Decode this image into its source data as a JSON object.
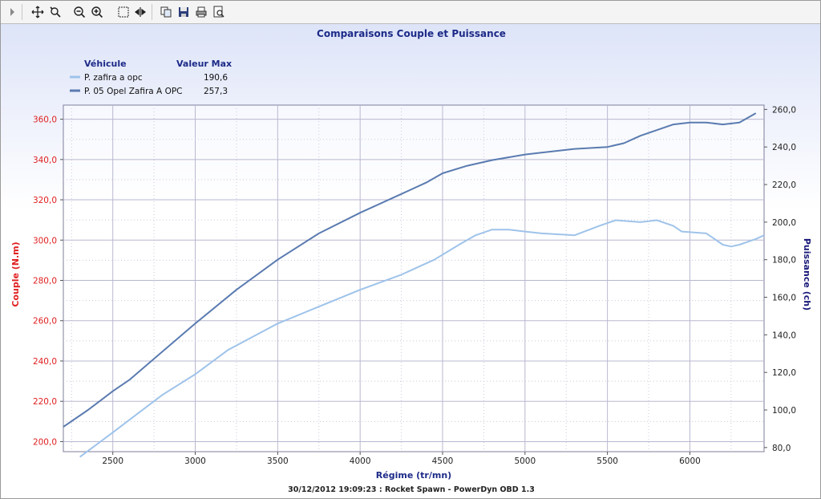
{
  "toolbar": {
    "icons": [
      "expand-arrow-icon",
      "pan-icon",
      "zoom-select-icon",
      "zoom-out-icon",
      "zoom-in-icon",
      "select-box-icon",
      "fit-width-icon",
      "copy-icon",
      "save-icon",
      "print-icon",
      "print-preview-icon"
    ]
  },
  "colors": {
    "torque_axis": "#e02020",
    "power_axis": "#1a1a7a",
    "series_light": "#9fc3ea",
    "series_dark": "#5a7bb0",
    "title": "#1c2a88"
  },
  "legend": {
    "header_vehicle": "Véhicule",
    "header_max": "Valeur Max",
    "entries": [
      {
        "name": "P. zafira a opc",
        "max": "190,6"
      },
      {
        "name": "P. 05 Opel Zafira A OPC",
        "max": "257,3"
      }
    ]
  },
  "footer": "30/12/2012 19:09:23 : Rocket Spawn - PowerDyn OBD 1.3",
  "chart_data": {
    "type": "line",
    "title": "Comparaisons Couple et Puissance",
    "xlabel": "Régime (tr/mn)",
    "ylabel": "Couple (N.m)",
    "y2label": "Puissance (ch)",
    "xlim": [
      2200,
      6450
    ],
    "ylim": [
      195,
      367
    ],
    "y2lim": [
      77.8,
      262.3
    ],
    "x_ticks": [
      "2500",
      "3000",
      "3500",
      "4000",
      "4500",
      "5000",
      "5500",
      "6000"
    ],
    "y_ticks": [
      "200,0",
      "220,0",
      "240,0",
      "260,0",
      "280,0",
      "300,0",
      "320,0",
      "340,0",
      "360,0"
    ],
    "y2_ticks": [
      "80,0",
      "100,0",
      "120,0",
      "140,0",
      "160,0",
      "180,0",
      "200,0",
      "220,0",
      "240,0",
      "260,0"
    ],
    "grid": true,
    "legend_position": "top-left",
    "series": [
      {
        "name": "P. zafira a opc",
        "axis": "right",
        "x": [
          2300,
          2500,
          2650,
          2800,
          3000,
          3200,
          3500,
          3750,
          4000,
          4250,
          4450,
          4600,
          4700,
          4800,
          4900,
          5000,
          5100,
          5300,
          5450,
          5550,
          5700,
          5800,
          5900,
          5950,
          6100,
          6200,
          6250,
          6300,
          6400,
          6450
        ],
        "values": [
          75,
          88,
          98,
          108,
          119,
          132,
          146,
          155,
          164,
          172,
          180,
          188,
          193,
          196,
          196,
          195,
          194,
          193,
          198,
          201,
          200,
          201,
          198,
          195,
          194,
          188,
          187,
          188,
          191,
          193
        ]
      },
      {
        "name": "P. 05 Opel Zafira A OPC",
        "axis": "right",
        "x": [
          2200,
          2350,
          2500,
          2600,
          2800,
          3000,
          3250,
          3500,
          3750,
          4000,
          4250,
          4400,
          4500,
          4650,
          4800,
          5000,
          5100,
          5300,
          5500,
          5600,
          5700,
          5900,
          6000,
          6100,
          6200,
          6300,
          6400
        ],
        "values": [
          91,
          100,
          110,
          116,
          131,
          146,
          164,
          180,
          194,
          205,
          215,
          221,
          226,
          230,
          233,
          236,
          237,
          239,
          240,
          242,
          246,
          252,
          253,
          253,
          252,
          253,
          258
        ]
      }
    ]
  }
}
